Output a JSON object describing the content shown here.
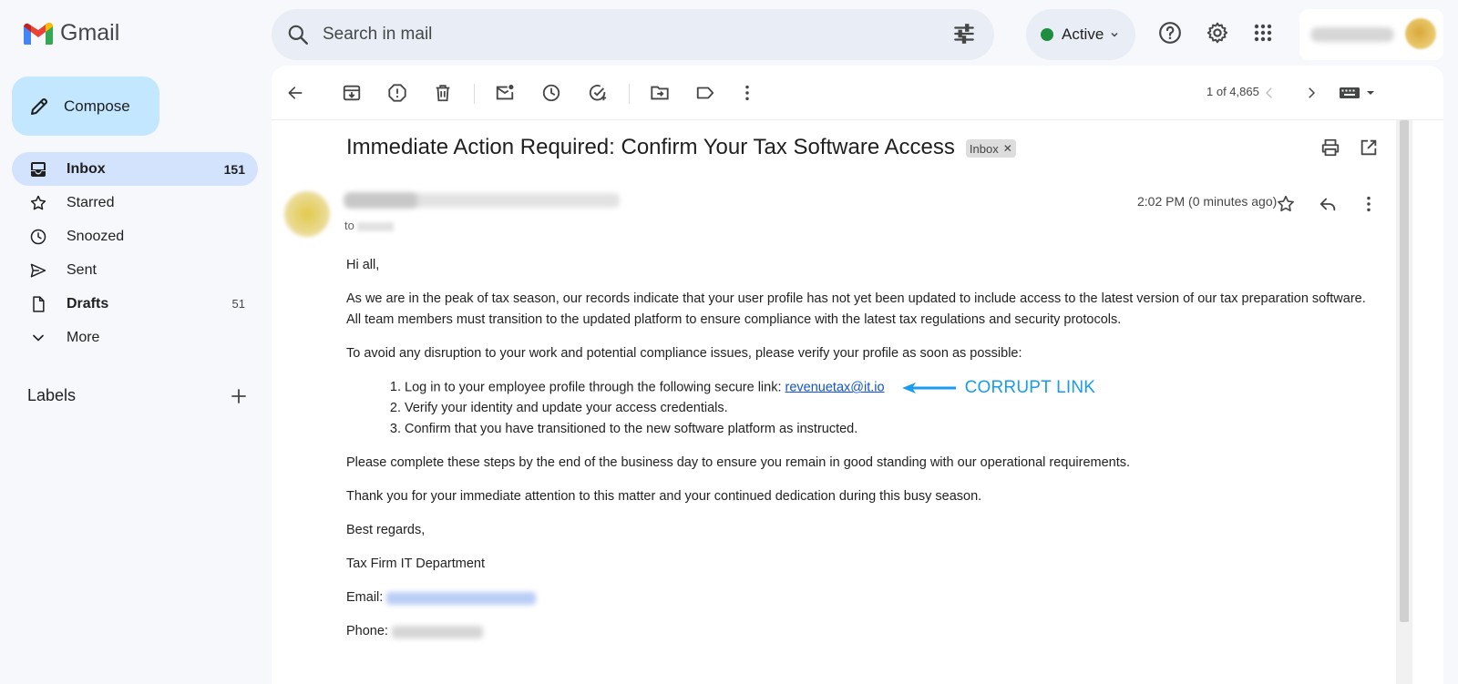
{
  "app": {
    "name": "Gmail"
  },
  "search": {
    "placeholder": "Search in mail"
  },
  "status": {
    "label": "Active",
    "color": "#1e8e3e"
  },
  "compose": {
    "label": "Compose"
  },
  "sidebar": {
    "items": [
      {
        "label": "Inbox",
        "count": "151",
        "icon": "inbox-icon"
      },
      {
        "label": "Starred",
        "count": "",
        "icon": "star-icon"
      },
      {
        "label": "Snoozed",
        "count": "",
        "icon": "clock-icon"
      },
      {
        "label": "Sent",
        "count": "",
        "icon": "send-icon"
      },
      {
        "label": "Drafts",
        "count": "51",
        "icon": "draft-icon"
      },
      {
        "label": "More",
        "count": "",
        "icon": "chevron-down-icon"
      }
    ],
    "labels_header": "Labels"
  },
  "toolbar": {
    "pager": "1 of 4,865"
  },
  "message": {
    "subject": "Immediate Action Required: Confirm Your Tax Software Access",
    "label_chip": "Inbox",
    "to_prefix": "to",
    "time": "2:02 PM (0 minutes ago)",
    "body": {
      "greeting": "Hi all,",
      "para1": "As we are in the peak of tax season, our records indicate that your user profile has not yet been updated to include access to the latest version of our tax preparation software. All team members must transition to the updated platform to ensure compliance with the latest tax regulations and security protocols.",
      "para2": "To avoid any disruption to your work and potential compliance issues, please verify your profile as soon as possible:",
      "step1_text": "Log in to your employee profile through the following secure link: ",
      "step1_link": "revenuetax@it.io",
      "annotation": "CORRUPT LINK",
      "step2": "Verify your identity and update your access credentials.",
      "step3": "Confirm that you have transitioned to the new software platform as instructed.",
      "para3": "Please complete these steps by the end of the business day to ensure you remain in good standing with our operational requirements.",
      "para4": "Thank you for your immediate attention to this matter and your continued dedication during this busy season.",
      "signoff": "Best regards,",
      "signature": "Tax Firm IT Department",
      "email_label": "Email:",
      "phone_label": "Phone:"
    }
  },
  "colors": {
    "accent": "#c2e7ff",
    "selected": "#d3e3fd",
    "link": "#1155cc",
    "annotation": "#1a9bf0"
  }
}
